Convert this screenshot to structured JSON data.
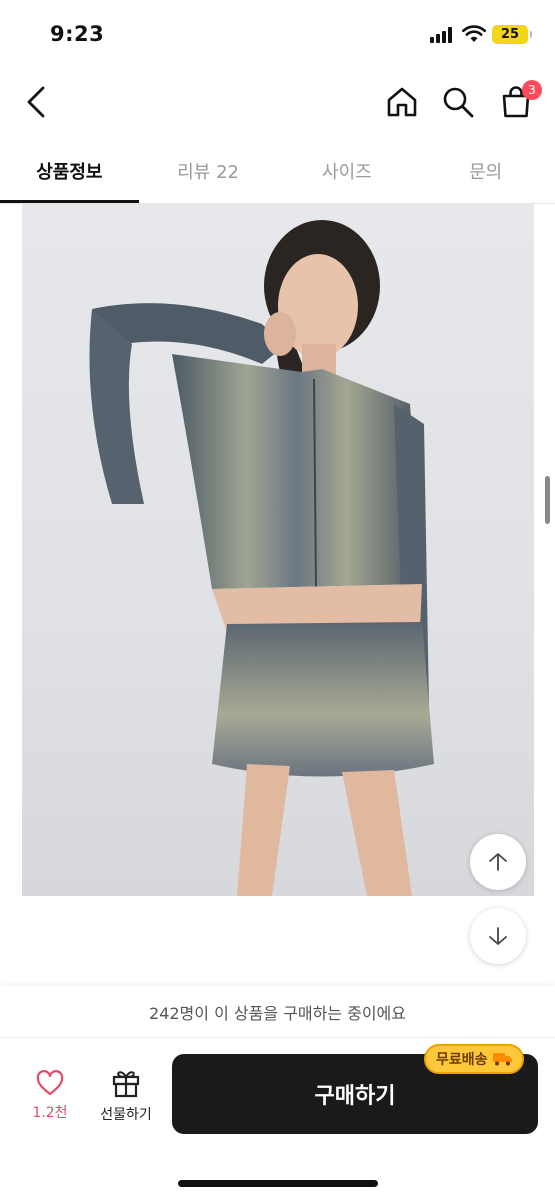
{
  "status_bar": {
    "time": "9:23",
    "battery": "25"
  },
  "header": {
    "cart_count": "3"
  },
  "tabs": [
    {
      "label": "상품정보",
      "active": true
    },
    {
      "label": "리뷰 22",
      "active": false
    },
    {
      "label": "사이즈",
      "active": false
    },
    {
      "label": "문의",
      "active": false
    }
  ],
  "bottom": {
    "buyers_notice": "242명이 이 상품을 구매하는 중이에요",
    "like_count": "1.2천",
    "gift_label": "선물하기",
    "buy_label": "구매하기",
    "shipping_badge": "무료배송"
  },
  "colors": {
    "accent": "#ff4b5c",
    "like": "#e64a6b",
    "buy_bg": "#1a1a1a",
    "badge_bg": "#ffc83a"
  }
}
